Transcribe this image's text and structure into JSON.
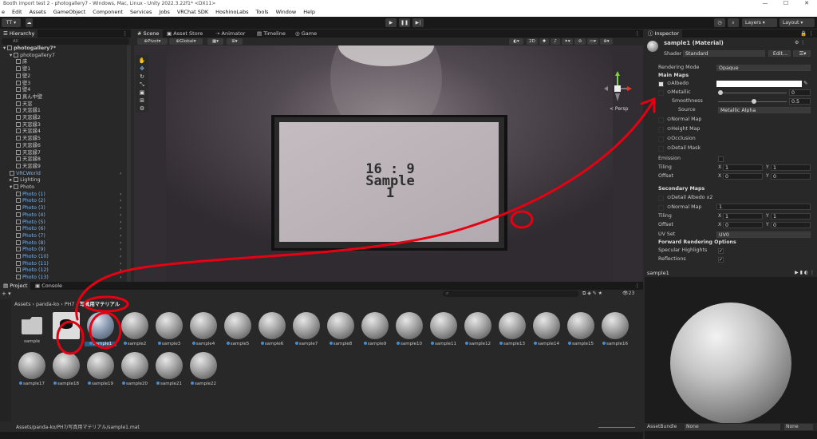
{
  "window": {
    "title": "Booth import test 2 - photogallery7 - Windows, Mac, Linux - Unity 2022.3.22f1* <DX11>",
    "controls": [
      "—",
      "☐",
      "✕"
    ]
  },
  "menu": [
    "e",
    "Edit",
    "Assets",
    "GameObject",
    "Component",
    "Services",
    "Jobs",
    "VRChat SDK",
    "HoshinoLabs",
    "Tools",
    "Window",
    "Help"
  ],
  "toolbar": {
    "account": "TT",
    "layers": "Layers",
    "layout": "Layout"
  },
  "hierarchy": {
    "tab": "Hierarchy",
    "search_placeholder": "All",
    "items": [
      {
        "label": "photogallery7*",
        "depth": 0,
        "bold": true
      },
      {
        "label": "photogallery7",
        "depth": 1
      },
      {
        "label": "床",
        "depth": 2
      },
      {
        "label": "壁1",
        "depth": 2
      },
      {
        "label": "壁2",
        "depth": 2
      },
      {
        "label": "壁3",
        "depth": 2
      },
      {
        "label": "壁4",
        "depth": 2
      },
      {
        "label": "真ん中壁",
        "depth": 2
      },
      {
        "label": "天窓",
        "depth": 2
      },
      {
        "label": "天窓縁1",
        "depth": 2
      },
      {
        "label": "天窓縁2",
        "depth": 2
      },
      {
        "label": "天窓縁3",
        "depth": 2
      },
      {
        "label": "天窓縁4",
        "depth": 2
      },
      {
        "label": "天窓縁5",
        "depth": 2
      },
      {
        "label": "天窓縁6",
        "depth": 2
      },
      {
        "label": "天窓縁7",
        "depth": 2
      },
      {
        "label": "天窓縁8",
        "depth": 2
      },
      {
        "label": "天窓縁9",
        "depth": 2
      },
      {
        "label": "VRCWorld",
        "depth": 1,
        "blue": true
      },
      {
        "label": "Lighting",
        "depth": 1
      },
      {
        "label": "Photo",
        "depth": 1
      },
      {
        "label": "Photo (1)",
        "depth": 2,
        "blue": true
      },
      {
        "label": "Photo (2)",
        "depth": 2,
        "blue": true
      },
      {
        "label": "Photo (3)",
        "depth": 2,
        "blue": true
      },
      {
        "label": "Photo (4)",
        "depth": 2,
        "blue": true
      },
      {
        "label": "Photo (5)",
        "depth": 2,
        "blue": true
      },
      {
        "label": "Photo (6)",
        "depth": 2,
        "blue": true
      },
      {
        "label": "Photo (7)",
        "depth": 2,
        "blue": true
      },
      {
        "label": "Photo (8)",
        "depth": 2,
        "blue": true
      },
      {
        "label": "Photo (9)",
        "depth": 2,
        "blue": true
      },
      {
        "label": "Photo (10)",
        "depth": 2,
        "blue": true
      },
      {
        "label": "Photo (11)",
        "depth": 2,
        "blue": true
      },
      {
        "label": "Photo (12)",
        "depth": 2,
        "blue": true
      },
      {
        "label": "Photo (13)",
        "depth": 2,
        "blue": true
      }
    ]
  },
  "scene": {
    "tabs": [
      "Scene",
      "Asset Store",
      "Animator",
      "Timeline",
      "Game"
    ],
    "pivot": "Pivot",
    "global": "Global",
    "mode_2d": "2D",
    "persp": "< Persp",
    "sample_text": {
      "line1": "16 : 9",
      "line2": "Sample",
      "line3": "1"
    }
  },
  "inspector": {
    "tab": "Inspector",
    "title": "sample1 (Material)",
    "shader_label": "Shader",
    "shader_value": "Standard",
    "edit_label": "Edit...",
    "rendering_mode_label": "Rendering Mode",
    "rendering_mode_value": "Opaque",
    "main_maps": "Main Maps",
    "albedo": "Albedo",
    "metallic": "Metallic",
    "metallic_value": "0",
    "smoothness": "Smoothness",
    "smoothness_value": "0.5",
    "source": "Source",
    "source_value": "Metallic Alpha",
    "normal_map": "Normal Map",
    "height_map": "Height Map",
    "occlusion": "Occlusion",
    "detail_mask": "Detail Mask",
    "emission": "Emission",
    "tiling": "Tiling",
    "offset": "Offset",
    "x": "X",
    "y": "Y",
    "tiling_x": "1",
    "tiling_y": "1",
    "offset_x": "0",
    "offset_y": "0",
    "secondary_maps": "Secondary Maps",
    "detail_albedo": "Detail Albedo x2",
    "normal_map2": "Normal Map",
    "normal_map2_value": "1",
    "tiling2_x": "1",
    "tiling2_y": "1",
    "offset2_x": "0",
    "offset2_y": "0",
    "uv_set": "UV Set",
    "uv_set_value": "UV0",
    "forward_options": "Forward Rendering Options",
    "specular": "Specular Highlights",
    "reflections": "Reflections",
    "metallic_slider": 0,
    "smoothness_slider": 0.5
  },
  "preview": {
    "name": "sample1",
    "assetbundle_label": "AssetBundle",
    "assetbundle_value": "None",
    "variant_value": "None"
  },
  "project": {
    "tabs": [
      "Project",
      "Console"
    ],
    "breadcrumb": [
      "Assets",
      "panda-ko",
      "PH7",
      "写真用マテリアル"
    ],
    "count": "23",
    "status_path": "Assets/panda-ko/PH7/写真用マテリアル/sample1.mat",
    "assets_row1": [
      "sample",
      "",
      "sample1",
      "sample2",
      "sample3",
      "sample4",
      "sample5",
      "sample6",
      "sample7",
      "sample8",
      "sample9",
      "sample10",
      "sample11",
      "sample12",
      "sample13",
      "sample14",
      "sample15",
      "sample16"
    ],
    "assets_row2": [
      "sample17",
      "sample18",
      "sample19",
      "sample20",
      "sample21",
      "sample22"
    ]
  },
  "colors": {
    "annotation": "#e60012",
    "selection": "#2c5d87",
    "link_blue": "#7ab3f0"
  }
}
